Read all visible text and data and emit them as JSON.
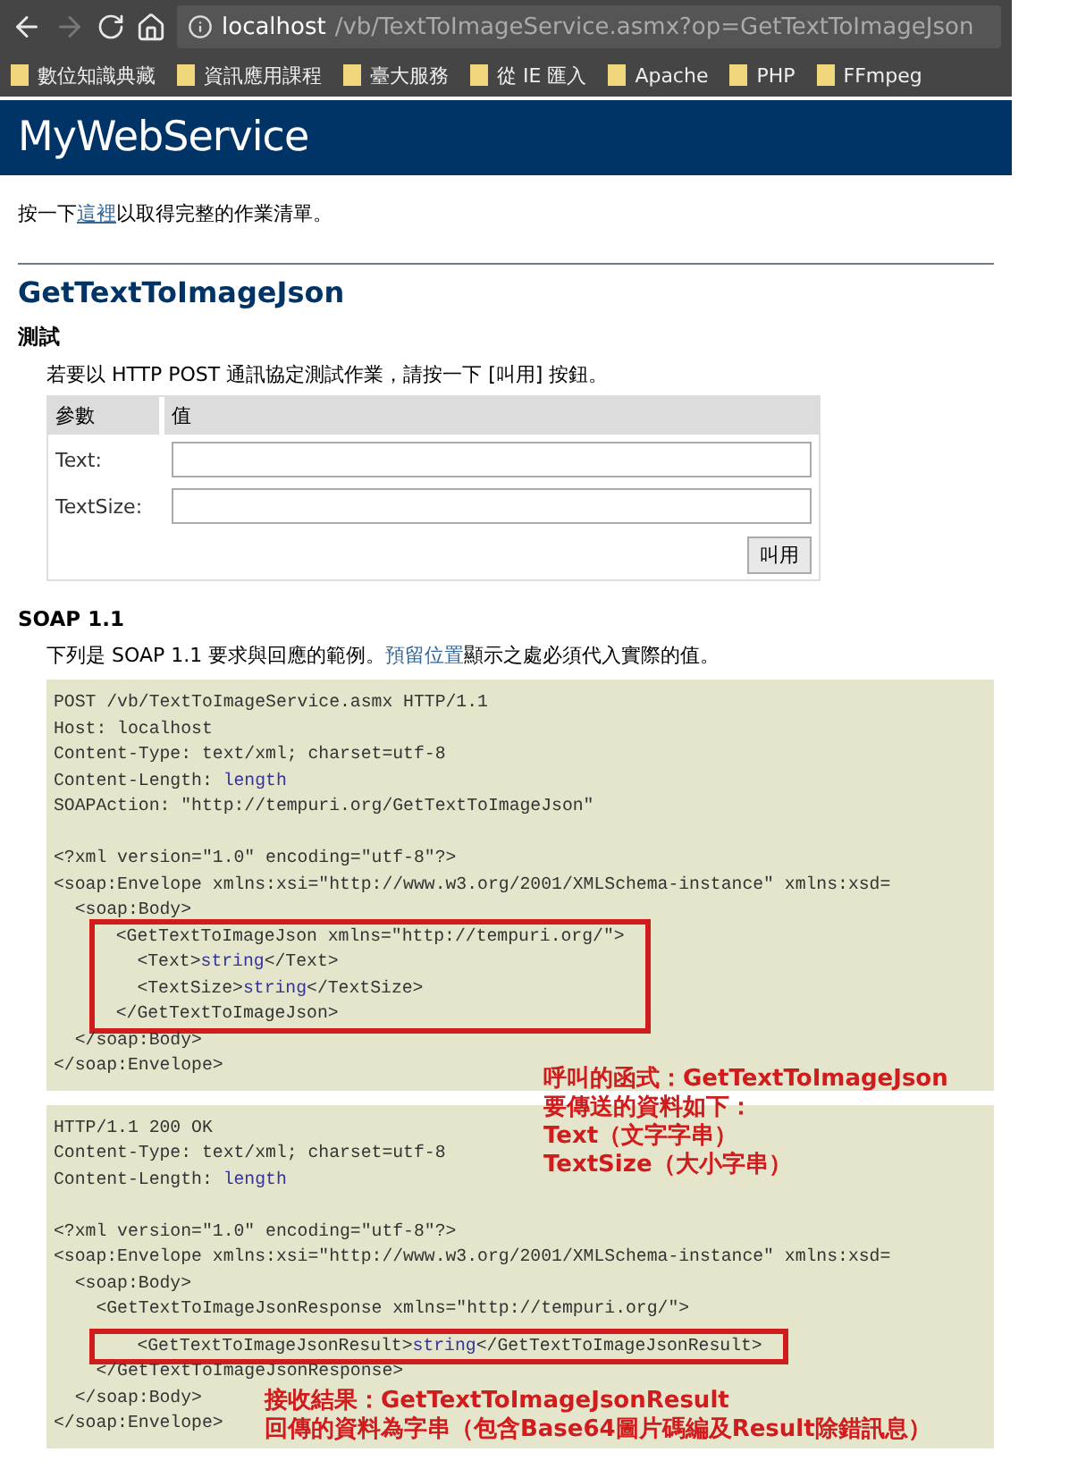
{
  "browser": {
    "back_enabled": true,
    "forward_enabled": false,
    "url_host": "localhost",
    "url_path": "/vb/TextToImageService.asmx?op=GetTextToImageJson",
    "bookmarks": [
      "數位知識典藏",
      "資訊應用課程",
      "臺大服務",
      "從 IE 匯入",
      "Apache",
      "PHP",
      "FFmpeg"
    ]
  },
  "header": {
    "title": "MyWebService"
  },
  "intro": {
    "before": "按一下",
    "link": "這裡",
    "after": "以取得完整的作業清單。"
  },
  "method": {
    "title": "GetTextToImageJson",
    "test": {
      "heading": "測試",
      "instruction": "若要以 HTTP POST 通訊協定測試作業，請按一下 [叫用] 按鈕。",
      "columns": [
        "參數",
        "值"
      ],
      "params": [
        {
          "label": "Text:"
        },
        {
          "label": "TextSize:"
        }
      ],
      "button": "叫用"
    },
    "soap": {
      "heading": "SOAP 1.1",
      "before": "下列是 SOAP 1.1 要求與回應的範例。",
      "link": "預留位置",
      "after": "顯示之處必須代入實際的值。",
      "blocks": [
        {
          "lines": [
            {
              "highlighted": false,
              "parts": [
                {
                  "text": "POST /vb/TextToImageService.asmx HTTP/1.1",
                  "placeholder": false
                }
              ]
            },
            {
              "highlighted": false,
              "parts": [
                {
                  "text": "Host: localhost",
                  "placeholder": false
                }
              ]
            },
            {
              "highlighted": false,
              "parts": [
                {
                  "text": "Content-Type: text/xml; charset=utf-8",
                  "placeholder": false
                }
              ]
            },
            {
              "highlighted": false,
              "parts": [
                {
                  "text": "Content-Length: ",
                  "placeholder": false
                },
                {
                  "text": "length",
                  "placeholder": true
                }
              ]
            },
            {
              "highlighted": false,
              "parts": [
                {
                  "text": "SOAPAction: \"http://tempuri.org/GetTextToImageJson\"",
                  "placeholder": false
                }
              ]
            },
            {
              "highlighted": false
            },
            {
              "highlighted": false,
              "parts": [
                {
                  "text": "<?xml version=\"1.0\" encoding=\"utf-8\"?>",
                  "placeholder": false
                }
              ]
            },
            {
              "highlighted": false,
              "parts": [
                {
                  "text": "<soap:Envelope xmlns:xsi=\"http://www.w3.org/2001/XMLSchema-instance\" xmlns:xsd=",
                  "placeholder": false
                }
              ]
            },
            {
              "highlighted": false,
              "parts": [
                {
                  "text": "  <soap:Body>",
                  "placeholder": false
                }
              ]
            },
            {
              "highlighted": true,
              "parts": [
                {
                  "text": "    <GetTextToImageJson xmlns=\"http://tempuri.org/\">",
                  "placeholder": false
                }
              ]
            },
            {
              "highlighted": true,
              "parts": [
                {
                  "text": "      <Text>",
                  "placeholder": false
                },
                {
                  "text": "string",
                  "placeholder": true
                },
                {
                  "text": "</Text>",
                  "placeholder": false
                }
              ]
            },
            {
              "highlighted": true,
              "parts": [
                {
                  "text": "      <TextSize>",
                  "placeholder": false
                },
                {
                  "text": "string",
                  "placeholder": true
                },
                {
                  "text": "</TextSize>",
                  "placeholder": false
                }
              ]
            },
            {
              "highlighted": true,
              "parts": [
                {
                  "text": "    </GetTextToImageJson>",
                  "placeholder": false
                }
              ]
            },
            {
              "highlighted": false,
              "parts": [
                {
                  "text": "  </soap:Body>",
                  "placeholder": false
                }
              ]
            },
            {
              "highlighted": false,
              "parts": [
                {
                  "text": "</soap:Envelope>",
                  "placeholder": false
                }
              ]
            }
          ],
          "note": [
            "呼叫的函式：GetTextToImageJson",
            "要傳送的資料如下：",
            "Text（文字字串）",
            "TextSize（大小字串）"
          ]
        },
        {
          "lines": [
            {
              "highlighted": false,
              "parts": [
                {
                  "text": "HTTP/1.1 200 OK",
                  "placeholder": false
                }
              ]
            },
            {
              "highlighted": false,
              "parts": [
                {
                  "text": "Content-Type: text/xml; charset=utf-8",
                  "placeholder": false
                }
              ]
            },
            {
              "highlighted": false,
              "parts": [
                {
                  "text": "Content-Length: ",
                  "placeholder": false
                },
                {
                  "text": "length",
                  "placeholder": true
                }
              ]
            },
            {
              "highlighted": false
            },
            {
              "highlighted": false,
              "parts": [
                {
                  "text": "<?xml version=\"1.0\" encoding=\"utf-8\"?>",
                  "placeholder": false
                }
              ]
            },
            {
              "highlighted": false,
              "parts": [
                {
                  "text": "<soap:Envelope xmlns:xsi=\"http://www.w3.org/2001/XMLSchema-instance\" xmlns:xsd=",
                  "placeholder": false
                }
              ]
            },
            {
              "highlighted": false,
              "parts": [
                {
                  "text": "  <soap:Body>",
                  "placeholder": false
                }
              ]
            },
            {
              "highlighted": false,
              "parts": [
                {
                  "text": "    <GetTextToImageJsonResponse xmlns=\"http://tempuri.org/\">",
                  "placeholder": false
                }
              ]
            },
            {
              "highlighted": true,
              "parts": [
                {
                  "text": "      <GetTextToImageJsonResult>",
                  "placeholder": false
                },
                {
                  "text": "string",
                  "placeholder": true
                },
                {
                  "text": "</GetTextToImageJsonResult>",
                  "placeholder": false
                }
              ]
            },
            {
              "highlighted": false,
              "parts": [
                {
                  "text": "    </GetTextToImageJsonResponse>",
                  "placeholder": false
                }
              ]
            },
            {
              "highlighted": false,
              "parts": [
                {
                  "text": "  </soap:Body>",
                  "placeholder": false
                }
              ]
            },
            {
              "highlighted": false,
              "parts": [
                {
                  "text": "</soap:Envelope>",
                  "placeholder": false
                }
              ]
            }
          ],
          "note": [
            "接收結果：GetTextToImageJsonResult",
            "回傳的資料為字串（包含Base64圖片碼編及Result除錯訊息）"
          ]
        }
      ]
    }
  }
}
